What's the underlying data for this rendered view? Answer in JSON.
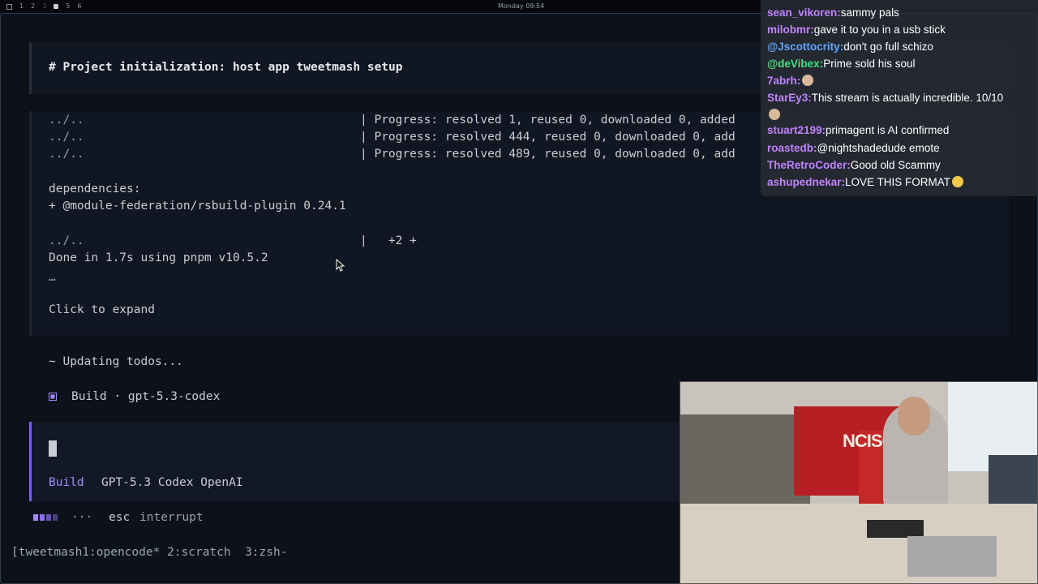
{
  "topbar": {
    "workspaces": [
      "1",
      "2",
      "3",
      "5",
      "6"
    ],
    "clock": "Monday 09:54"
  },
  "terminal": {
    "heading": "# Project initialization: host app tweetmash setup",
    "progress_lines": [
      {
        "path": "../..",
        "text": "| Progress: resolved 1, reused 0, downloaded 0, added"
      },
      {
        "path": "../..",
        "text": "| Progress: resolved 444, reused 0, downloaded 0, add"
      },
      {
        "path": "../..",
        "text": "| Progress: resolved 489, reused 0, downloaded 0, add"
      }
    ],
    "deps_label": "dependencies:",
    "dep_line": "+ @module-federation/rsbuild-plugin 0.24.1",
    "summary_path": "../..",
    "summary_text": "|   +2 +",
    "done_line": "Done in 1.7s using pnpm v10.5.2",
    "ellipsis": "…",
    "expand": "Click to expand",
    "updating": "~ Updating todos...",
    "build_icon": "square-icon",
    "build_line": "Build · gpt-5.3-codex",
    "prompt_mode": "Build",
    "prompt_model": "GPT-5.3 Codex OpenAI",
    "progress_dots": "···",
    "interrupt_key": "esc",
    "interrupt_label": "interrupt",
    "accent_color": "#a78bfa"
  },
  "tmux": {
    "status": "[tweetmash1:opencode* 2:scratch  3:zsh-"
  },
  "chat": {
    "messages": [
      {
        "user": "sean_vikoren:",
        "text": "sammy pals",
        "color": "#c084fc"
      },
      {
        "user": "milobmr:",
        "text": "gave it to you in a usb stick",
        "color": "#c084fc"
      },
      {
        "user": "@Jscottocrity:",
        "text": "don't go full schizo",
        "color": "#60a5fa"
      },
      {
        "user": "@deVibex:",
        "text": "Prime sold his soul",
        "color": "#4ade80"
      },
      {
        "user": "7abrh:",
        "text": "",
        "color": "#c084fc",
        "emote": true
      },
      {
        "user": "StarEy3:",
        "text": "This stream is actually incredible. 10/10",
        "color": "#c084fc"
      },
      {
        "user": "stuart2199:",
        "text": "primagent is AI confirmed",
        "color": "#c084fc"
      },
      {
        "user": "roastedb:",
        "text": "@nightshadedude emote",
        "color": "#c084fc"
      },
      {
        "user": "TheRetroCoder:",
        "text": "Good old Scammy",
        "color": "#c084fc"
      },
      {
        "user": "ashupednekar:",
        "text": "LOVE THIS FORMAT",
        "color": "#c084fc",
        "emote_after": true
      }
    ]
  },
  "webcam": {
    "sign_text": "NCISCO"
  }
}
